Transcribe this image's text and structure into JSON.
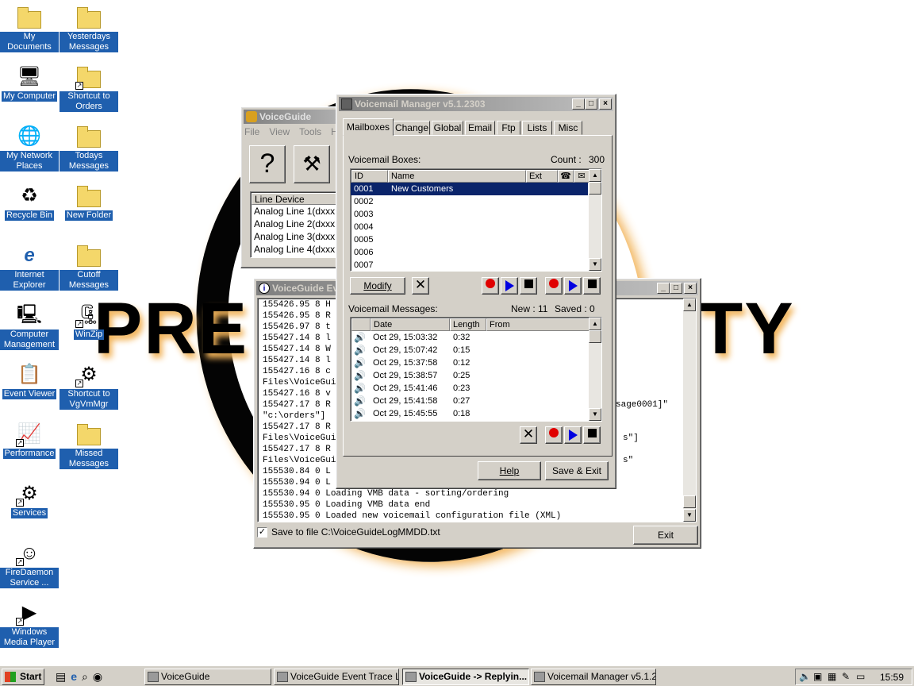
{
  "colors": {
    "desktop": "#ffffff",
    "selection": "#0a246a",
    "title_active": "#0a246a",
    "icon_label_bg": "#1f5fae",
    "glow": "#f2b45a"
  },
  "wallpaper": {
    "word_left": "PRE",
    "word_right": "TY"
  },
  "desktop_icons": [
    {
      "label": "My Documents",
      "icon": "my-documents-icon"
    },
    {
      "label": "Yesterdays Messages",
      "icon": "folder-icon"
    },
    {
      "label": "My Computer",
      "icon": "my-computer-icon"
    },
    {
      "label": "Shortcut to Orders",
      "icon": "shortcut-folder-icon"
    },
    {
      "label": "My Network Places",
      "icon": "network-places-icon"
    },
    {
      "label": "Todays Messages",
      "icon": "folder-icon"
    },
    {
      "label": "Recycle Bin",
      "icon": "recycle-bin-icon"
    },
    {
      "label": "New Folder",
      "icon": "folder-icon"
    },
    {
      "label": "Internet Explorer",
      "icon": "internet-explorer-icon"
    },
    {
      "label": "Cutoff Messages",
      "icon": "folder-icon"
    },
    {
      "label": "Computer Management",
      "icon": "computer-management-icon"
    },
    {
      "label": "WinZip",
      "icon": "winzip-icon"
    },
    {
      "label": "Event Viewer",
      "icon": "event-viewer-icon"
    },
    {
      "label": "Shortcut to VgVmMgr",
      "icon": "shortcut-tool-icon"
    },
    {
      "label": "Performance",
      "icon": "performance-icon"
    },
    {
      "label": "Missed Messages",
      "icon": "folder-icon"
    },
    {
      "label": "Services",
      "icon": "services-icon"
    },
    {
      "label": "FireDaemon Service ...",
      "icon": "firedaemon-icon"
    },
    {
      "label": "Windows Media Player",
      "icon": "media-player-icon"
    }
  ],
  "voiceguide": {
    "title": "VoiceGuide",
    "menu": [
      "File",
      "View",
      "Tools",
      "He"
    ],
    "line_header": "Line Device",
    "lines": [
      "Analog Line 1(dxxxB1",
      "Analog Line 2(dxxxB1",
      "Analog Line 3(dxxxB1",
      "Analog Line 4(dxxxB1"
    ]
  },
  "eventlog": {
    "title": "VoiceGuide Eve",
    "lines": [
      "155426.95  8 H",
      "155426.95  8 R",
      "155426.97  8 t",
      "155427.14  8 l",
      "155427.14  8 W",
      "155427.14  8 l",
      "155427.16  8 c",
      "Files\\VoiceGui",
      "155427.16  8 v",
      "155427.17  8 R",
      "\"c:\\orders\"]",
      "155427.17  8 R",
      "Files\\VoiceGui",
      "155427.17  8 R",
      "Files\\VoiceGui",
      "155530.84  0 L",
      "155530.94  0 L",
      "155530.94  0 Loading VMB data - sorting/ordering",
      "155530.95  0 Loading VMB data end",
      "155530.95  0 Loaded new voicemail configuration file (XML)"
    ],
    "right_fragments": [
      "sage0001]\"",
      "s\"]",
      "s\""
    ],
    "save_label": "Save to file C:\\VoiceGuideLogMMDD.txt",
    "save_checked": true,
    "exit_label": "Exit"
  },
  "vmm": {
    "title": "Voicemail Manager v5.1.2303",
    "tabs": [
      "Mailboxes",
      "Change",
      "Global",
      "Email",
      "Ftp",
      "Lists",
      "Misc"
    ],
    "boxes_label": "Voicemail Boxes:",
    "count_label": "Count :",
    "count_value": "300",
    "box_cols": [
      "ID",
      "Name",
      "Ext"
    ],
    "boxes": [
      {
        "id": "0001",
        "name": "New Customers",
        "selected": true
      },
      {
        "id": "0002",
        "name": ""
      },
      {
        "id": "0003",
        "name": ""
      },
      {
        "id": "0004",
        "name": ""
      },
      {
        "id": "0005",
        "name": ""
      },
      {
        "id": "0006",
        "name": ""
      },
      {
        "id": "0007",
        "name": ""
      }
    ],
    "modify_label": "Modify",
    "messages_label": "Voicemail Messages:",
    "new_label": "New : 11",
    "saved_label": "Saved : 0",
    "msg_cols": [
      "Date",
      "Length",
      "From"
    ],
    "messages": [
      {
        "date": "Oct 29, 15:03:32",
        "length": "0:32"
      },
      {
        "date": "Oct 29, 15:07:42",
        "length": "0:15"
      },
      {
        "date": "Oct 29, 15:37:58",
        "length": "0:12"
      },
      {
        "date": "Oct 29, 15:38:57",
        "length": "0:25"
      },
      {
        "date": "Oct 29, 15:41:46",
        "length": "0:23"
      },
      {
        "date": "Oct 29, 15:41:58",
        "length": "0:27"
      },
      {
        "date": "Oct 29, 15:45:55",
        "length": "0:18"
      }
    ],
    "help_label": "Help",
    "save_exit_label": "Save & Exit"
  },
  "taskbar": {
    "start_label": "Start",
    "items": [
      {
        "label": "VoiceGuide",
        "pressed": false
      },
      {
        "label": "VoiceGuide Event Trace Log",
        "pressed": false
      },
      {
        "label": "VoiceGuide -> Replyin...",
        "pressed": true
      },
      {
        "label": "Voicemail Manager v5.1.2...",
        "pressed": false
      }
    ],
    "clock": "15:59"
  }
}
